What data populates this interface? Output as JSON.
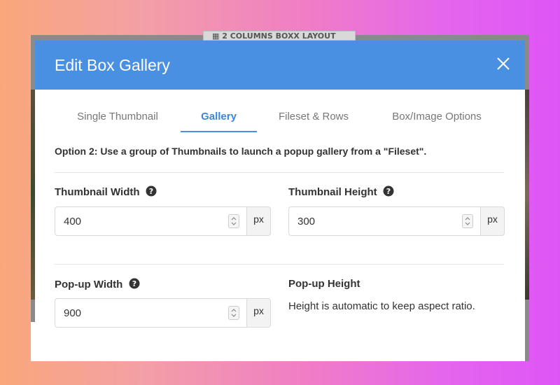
{
  "background": {
    "top_strip_label": "2 COLUMNS BOXX LAYOUT"
  },
  "modal": {
    "title": "Edit Box Gallery",
    "close_icon": "close-icon",
    "tabs": [
      {
        "label": "Single Thumbnail",
        "active": false
      },
      {
        "label": "Gallery",
        "active": true
      },
      {
        "label": "Fileset & Rows",
        "active": false
      },
      {
        "label": "Box/Image Options",
        "active": false
      }
    ],
    "intro": "Option 2: Use a group of Thumbnails to launch a popup gallery from a \"Fileset\".",
    "fields": {
      "thumb_width": {
        "label": "Thumbnail Width",
        "value": "400",
        "unit": "px"
      },
      "thumb_height": {
        "label": "Thumbnail Height",
        "value": "300",
        "unit": "px"
      },
      "popup_width": {
        "label": "Pop-up Width",
        "value": "900",
        "unit": "px"
      },
      "popup_height": {
        "label": "Pop-up Height",
        "note": "Height is automatic to keep aspect ratio."
      }
    }
  },
  "colors": {
    "header": "#4a90e2",
    "active_tab": "#3a87d6"
  }
}
